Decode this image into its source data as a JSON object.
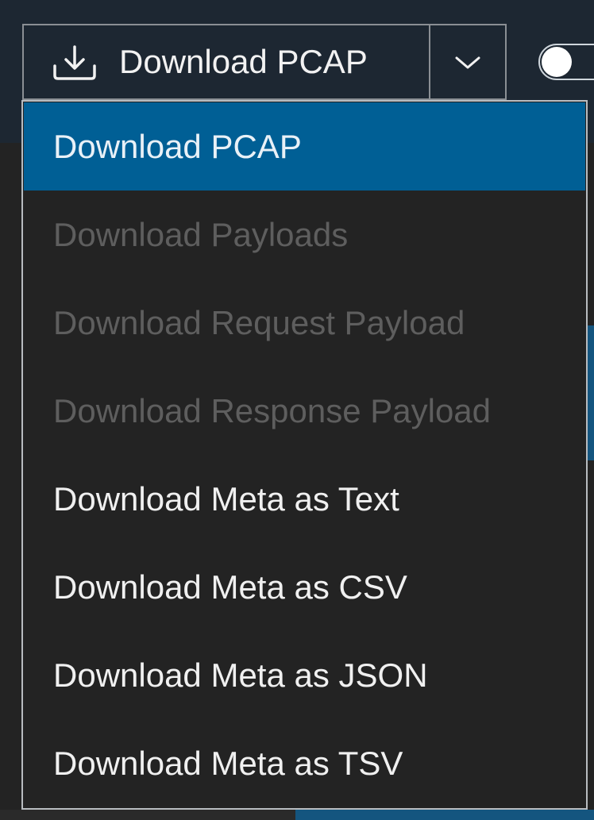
{
  "toolbar": {
    "main_label": "Download PCAP",
    "main_icon": "download-icon",
    "caret_icon": "chevron-down-icon",
    "toggle_state": "off"
  },
  "menu": {
    "items": [
      {
        "label": "Download PCAP",
        "state": "active"
      },
      {
        "label": "Download Payloads",
        "state": "disabled"
      },
      {
        "label": "Download Request Payload",
        "state": "disabled"
      },
      {
        "label": "Download Response Payload",
        "state": "disabled"
      },
      {
        "label": "Download Meta as Text",
        "state": "enabled"
      },
      {
        "label": "Download Meta as CSV",
        "state": "enabled"
      },
      {
        "label": "Download Meta as JSON",
        "state": "enabled"
      },
      {
        "label": "Download Meta as TSV",
        "state": "enabled"
      }
    ]
  },
  "colors": {
    "active_bg": "#005f95",
    "toolbar_bg": "#1d2732",
    "menu_bg": "#232323",
    "disabled_text": "#5e5e5e"
  }
}
